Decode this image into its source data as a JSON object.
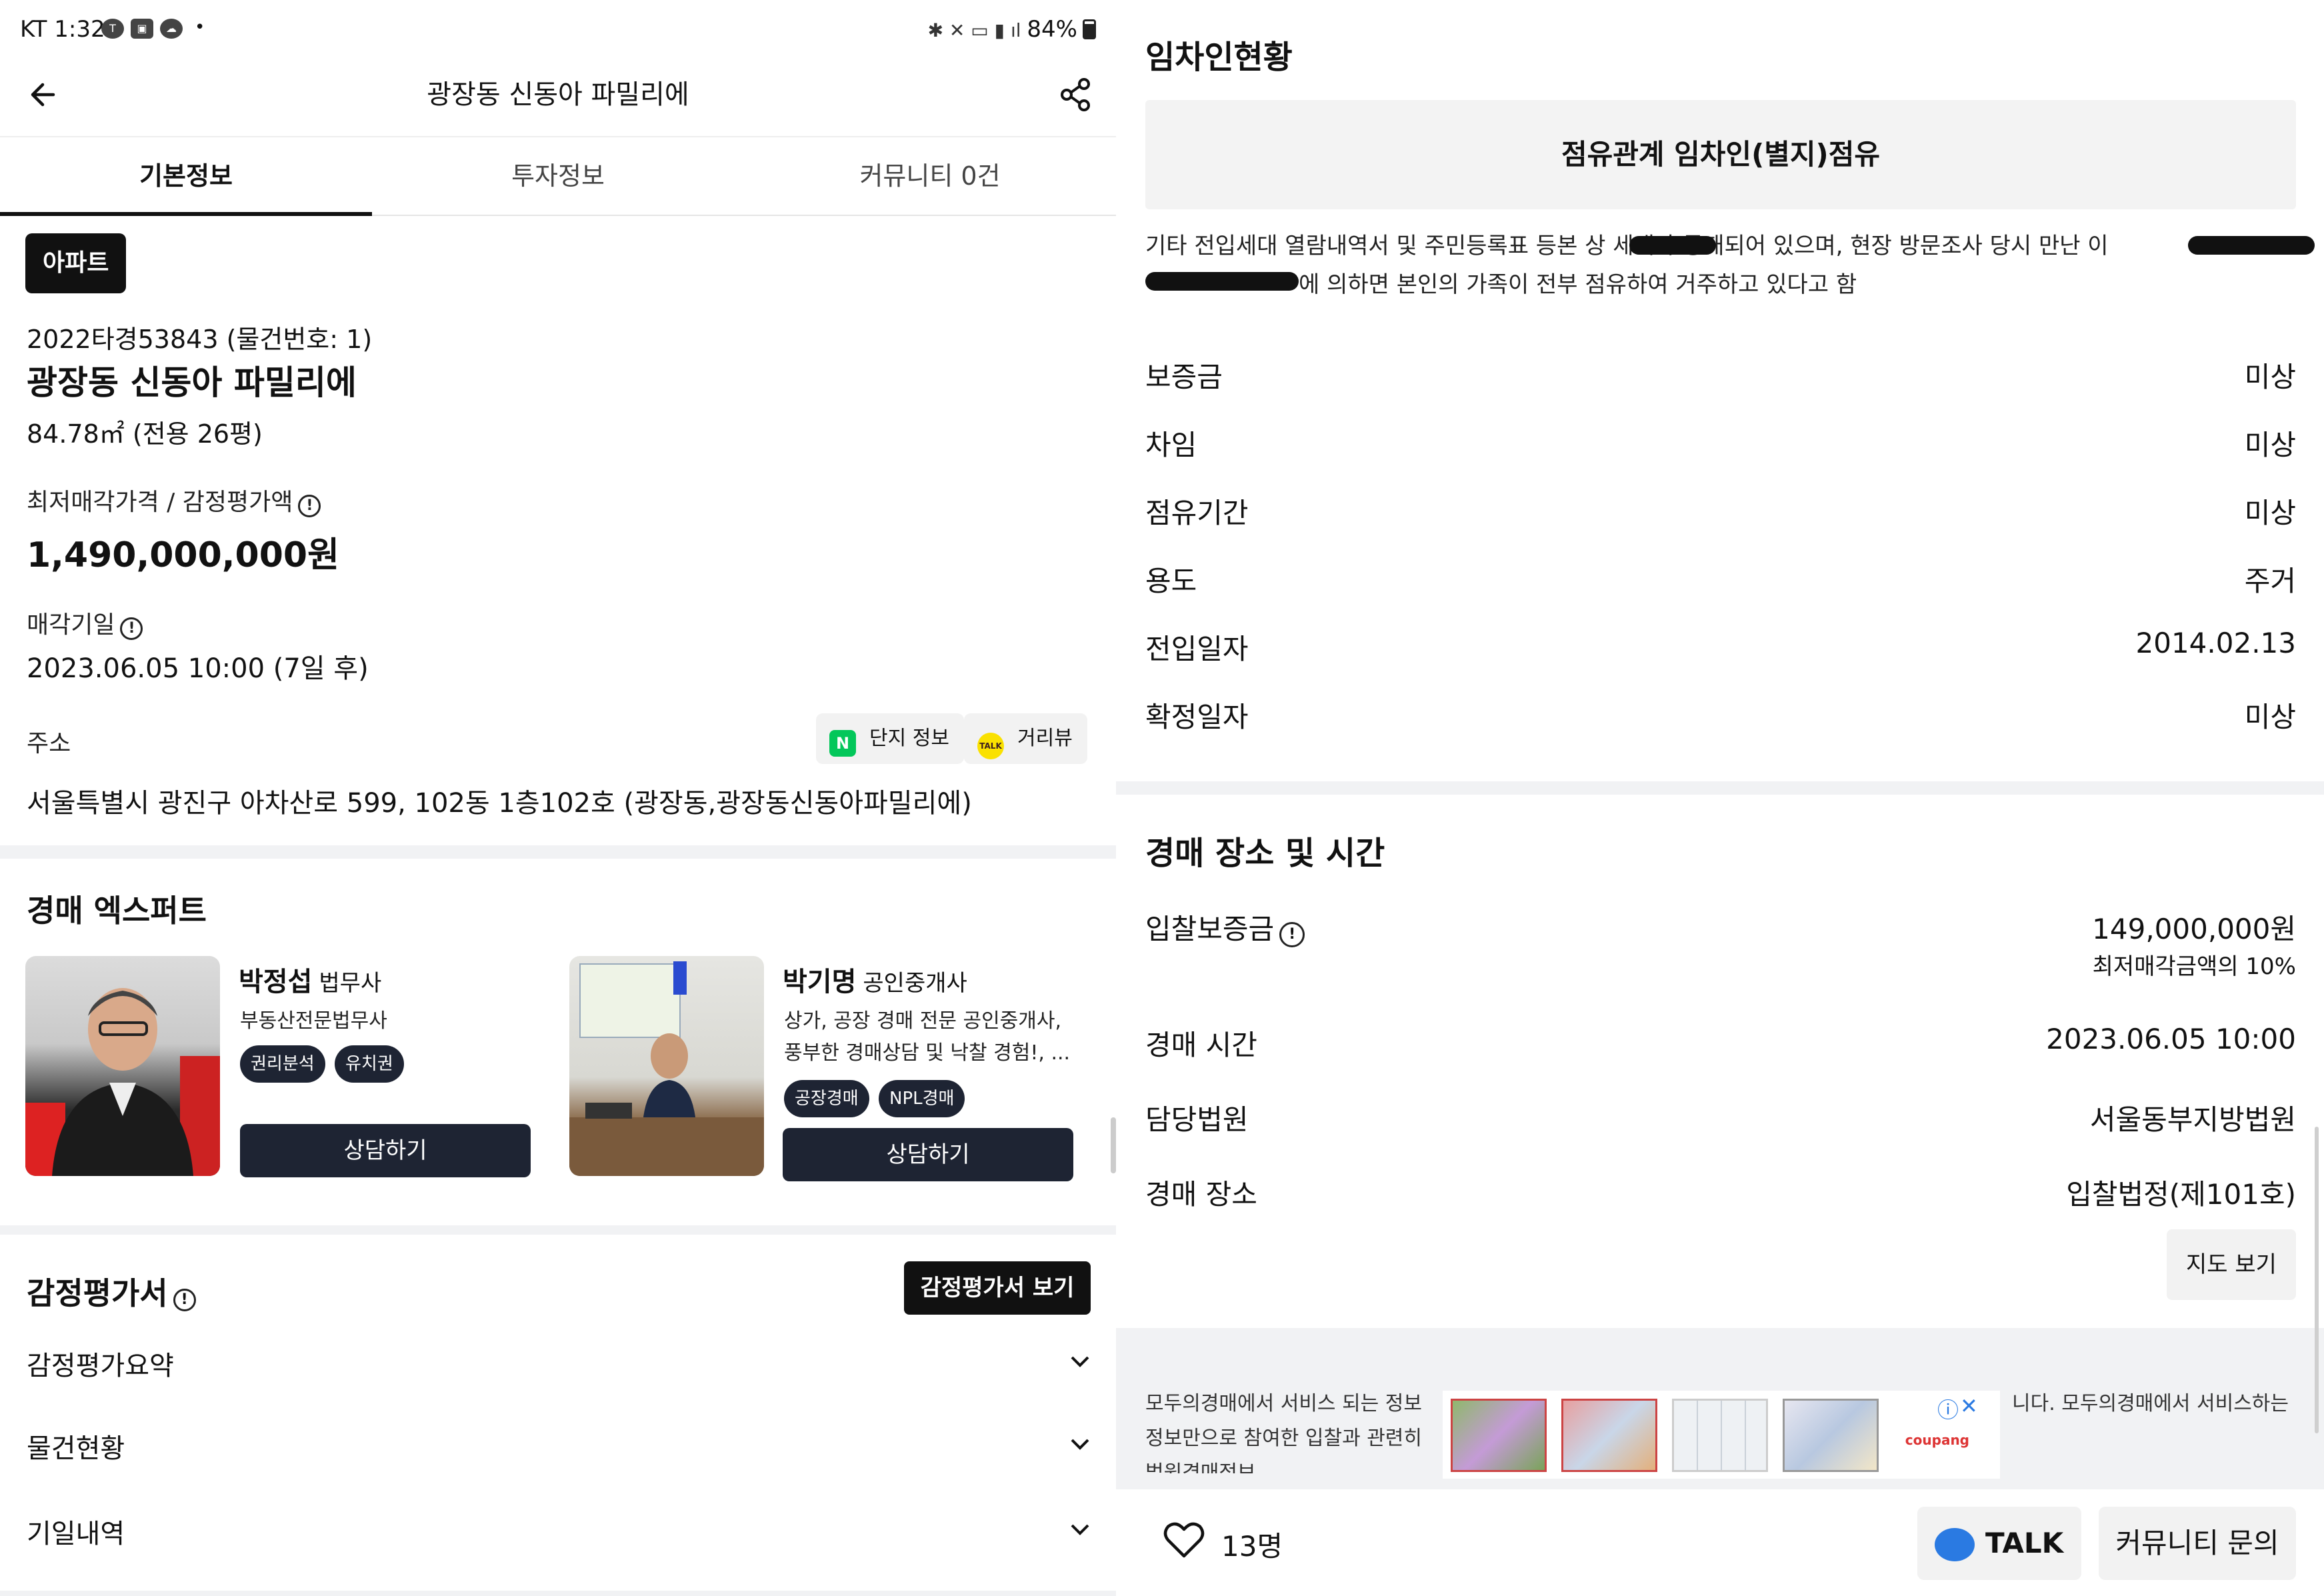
{
  "status_bar": {
    "carrier_time": "KT 1:32",
    "icons_left": [
      "talk-icon",
      "image-icon",
      "cloud-icon"
    ],
    "battery": "84%"
  },
  "header": {
    "title": "광장동 신동아 파밀리에"
  },
  "tabs": [
    {
      "label": "기본정보",
      "active": true
    },
    {
      "label": "투자정보",
      "active": false
    },
    {
      "label": "커뮤니티 0건",
      "active": false
    }
  ],
  "property": {
    "type_chip": "아파트",
    "case_no": "2022타경53843 (물건번호: 1)",
    "name": "광장동 신동아 파밀리에",
    "size": "84.78㎡ (전용 26평)",
    "price_label": "최저매각가격 / 감정평가액",
    "price_value": "1,490,000,000원",
    "date_label": "매각기일",
    "date_value": "2023.06.05 10:00 (7일 후)",
    "address_label": "주소",
    "address_value": "서울특별시 광진구 아차산로 599, 102동 1층102호 (광장동,광장동신동아파밀리에)",
    "complex_info_btn": "단지 정보",
    "street_view_btn": "거리뷰",
    "naver_badge": "N",
    "kakao_badge": "TALK"
  },
  "experts": {
    "title": "경매 엑스퍼트",
    "items": [
      {
        "name": "박정섭",
        "role": "법무사",
        "desc": [
          "부동산전문법무사"
        ],
        "tags": [
          "권리분석",
          "유치권"
        ],
        "button": "상담하기"
      },
      {
        "name": "박기명",
        "role": "공인중개사",
        "desc": [
          "상가, 공장 경매 전문 공인중개사,",
          "풍부한 경매상담 및 낙찰 경험!, ..."
        ],
        "tags": [
          "공장경매",
          "NPL경매"
        ],
        "button": "상담하기"
      }
    ]
  },
  "appraisal": {
    "title": "감정평가서",
    "view_button": "감정평가서 보기",
    "rows": [
      "감정평가요약",
      "물건현황",
      "기일내역"
    ]
  },
  "tenants": {
    "title": "임차인현황",
    "occupancy": "점유관계 임차인(별지)점유",
    "description_line1": "기타 전입세대 열람내역서 및 주민등록표 등본 상 세대가 등재되어 있으며, 현장 방문조사 당시 만난 이",
    "description_line2": "에 의하면 본인의 가족이 전부 점유하여 거주하고 있다고 함",
    "rows": [
      {
        "key": "보증금",
        "value": "미상"
      },
      {
        "key": "차임",
        "value": "미상"
      },
      {
        "key": "점유기간",
        "value": "미상"
      },
      {
        "key": "용도",
        "value": "주거"
      },
      {
        "key": "전입일자",
        "value": "2014.02.13"
      },
      {
        "key": "확정일자",
        "value": "미상"
      }
    ]
  },
  "auction": {
    "title": "경매 장소 및 시간",
    "deposit_label": "입찰보증금",
    "deposit_value": "149,000,000원",
    "deposit_sub": "최저매각금액의 10%",
    "time_label": "경매 시간",
    "time_value": "2023.06.05 10:00",
    "court_label": "담당법원",
    "court_value": "서울동부지방법원",
    "place_label": "경매 장소",
    "place_value": "입찰법정(제101호)",
    "map_button": "지도 보기"
  },
  "footer": {
    "line1_left": "모두의경매에서 서비스 되는 정보",
    "line1_right": "니다. 모두의경매에서 서비스하는",
    "line2_left": "정보만으로 참여한 입찰과 관련히",
    "line3": "법원경매정보",
    "ad_brand": "coupang"
  },
  "bottom_bar": {
    "like_count": "13명",
    "talk_label": "TALK",
    "community_label": "커뮤니티 문의"
  }
}
